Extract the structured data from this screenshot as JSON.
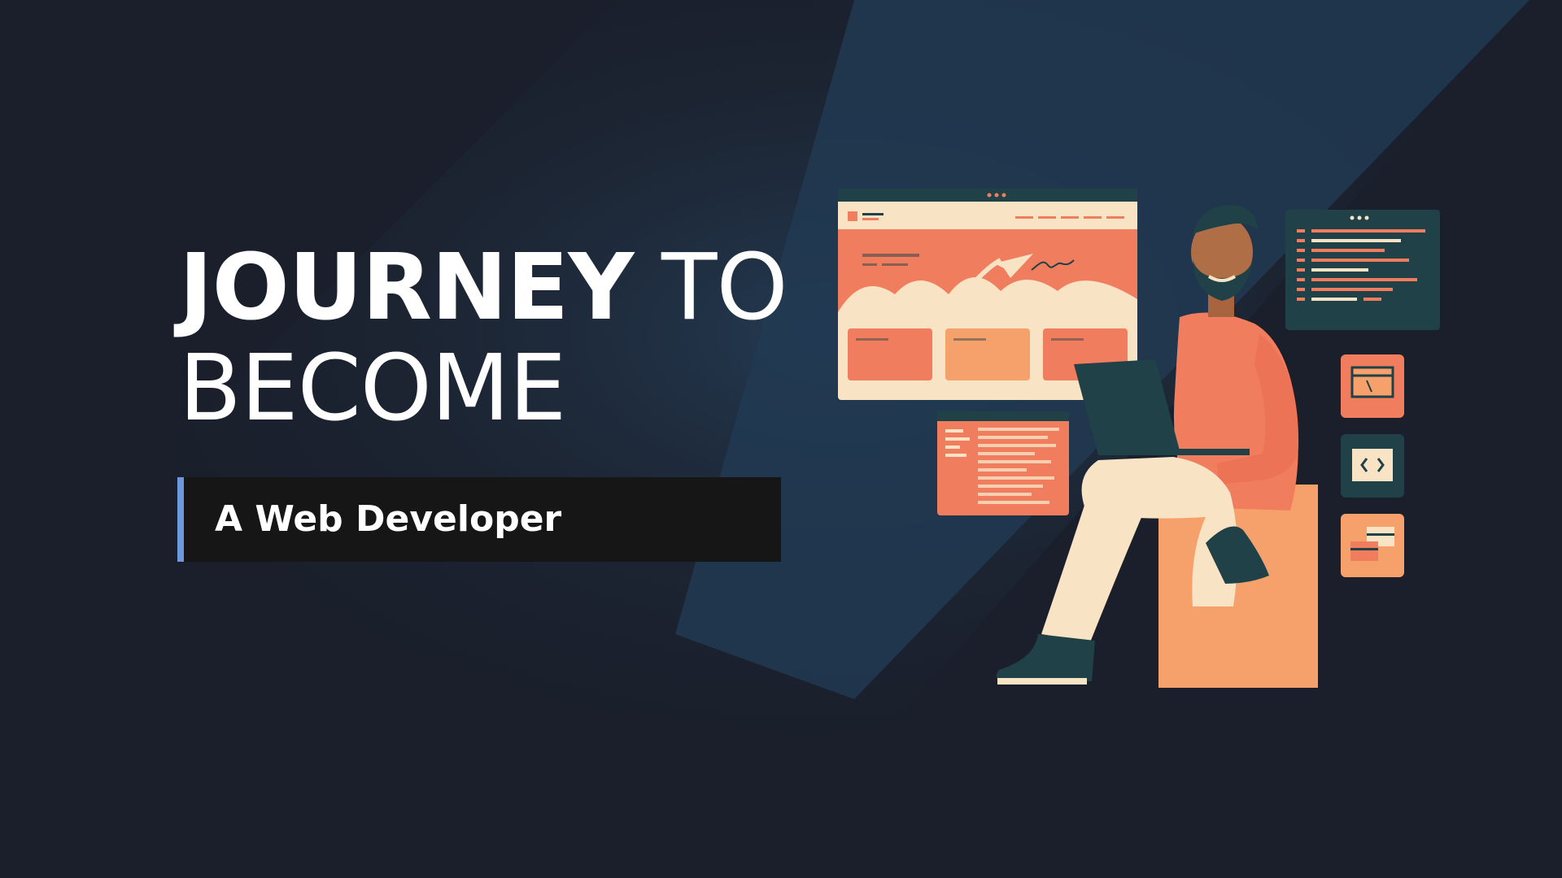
{
  "title": {
    "word1": "JOURNEY",
    "word2": "TO",
    "word3": "BECOME"
  },
  "subtitle": "A Web Developer",
  "colors": {
    "background": "#1a1f2b",
    "diagonal_band": "#213a52",
    "accent_bar": "#6f98dc",
    "subtitle_bg": "#161616",
    "illustration_orange": "#f07e5e",
    "illustration_cream": "#f8e3c4",
    "illustration_teal": "#1f4147"
  },
  "icons": [
    "code-brackets-icon",
    "terminal-window-icon",
    "layout-window-icon",
    "paper-plane-icon"
  ]
}
